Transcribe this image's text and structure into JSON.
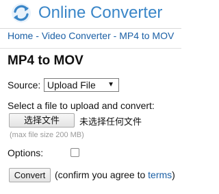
{
  "header": {
    "site_title": "Online Converter",
    "logo_icon": "refresh-arrows-icon",
    "brand_color": "#3a86c8"
  },
  "breadcrumb": {
    "items": [
      "Home",
      "Video Converter",
      "MP4 to MOV"
    ],
    "separator": " - ",
    "link_color": "#1a5fa5"
  },
  "page": {
    "title": "MP4 to MOV"
  },
  "form": {
    "source_label": "Source:",
    "source_selected": "Upload File",
    "source_arrow_icon": "dropdown-arrow-icon",
    "instructions": "Select a file to upload and convert:",
    "file_button_label": "选择文件",
    "no_file_text": "未选择任何文件",
    "max_size_note": "(max file size 200 MB)",
    "options_label": "Options:",
    "options_checked": false,
    "convert_button_label": "Convert",
    "confirm_prefix": "(confirm you agree to ",
    "terms_link": "terms",
    "confirm_suffix": ")"
  }
}
